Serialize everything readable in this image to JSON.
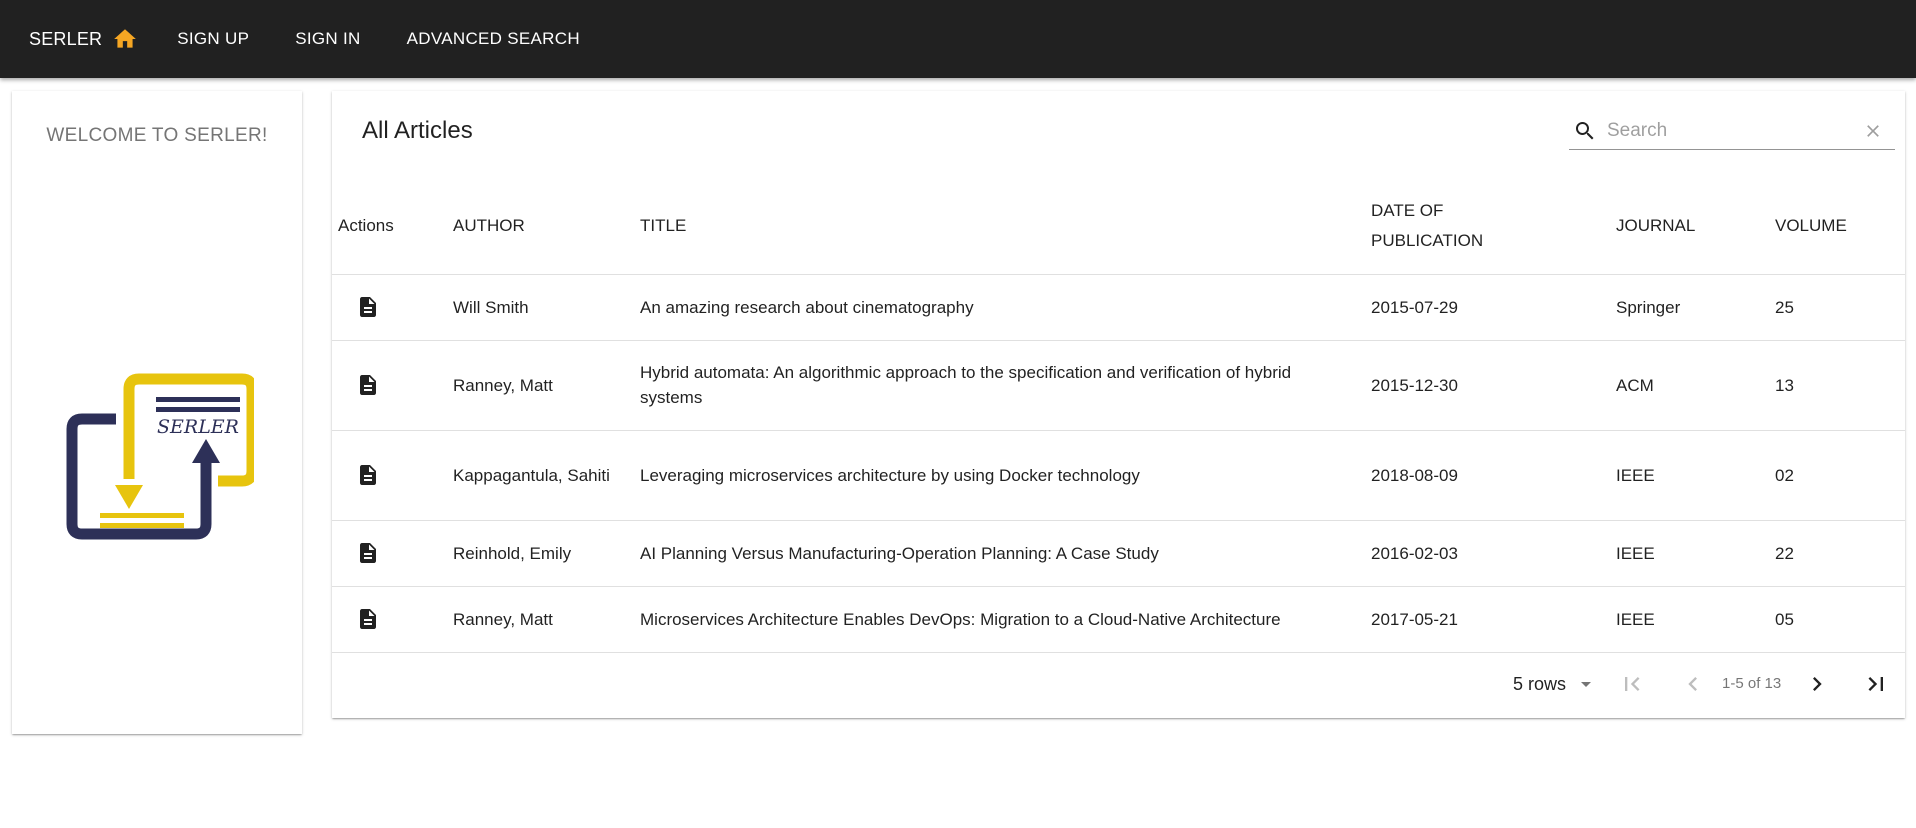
{
  "nav": {
    "brand": "SERLER",
    "sign_up": "SIGN UP",
    "sign_in": "SIGN IN",
    "advanced_search": "ADVANCED SEARCH",
    "home_icon": "home-icon",
    "accent_color": "#f5a623"
  },
  "sidebar": {
    "welcome": "WELCOME TO SERLER!",
    "logo_text": "SERLER"
  },
  "main": {
    "title": "All Articles",
    "search": {
      "placeholder": "Search",
      "value": ""
    },
    "columns": {
      "actions": "Actions",
      "author": "AUTHOR",
      "title": "TITLE",
      "date_line1": "DATE OF",
      "date_line2": "PUBLICATION",
      "journal": "JOURNAL",
      "volume": "VOLUME"
    },
    "rows": [
      {
        "author": "Will Smith",
        "title": "An amazing research about cinematography",
        "date": "2015-07-29",
        "journal": "Springer",
        "volume": "25"
      },
      {
        "author": "Ranney, Matt",
        "title": "Hybrid automata: An algorithmic approach to the specification and verification of hybrid systems",
        "date": "2015-12-30",
        "journal": "ACM",
        "volume": "13"
      },
      {
        "author": "Kappagantula, Sahiti",
        "title": "Leveraging microservices architecture by using Docker technology",
        "date": "2018-08-09",
        "journal": "IEEE",
        "volume": "02"
      },
      {
        "author": "Reinhold, Emily",
        "title": "AI Planning Versus Manufacturing-Operation Planning: A Case Study",
        "date": "2016-02-03",
        "journal": "IEEE",
        "volume": "22"
      },
      {
        "author": "Ranney, Matt",
        "title": "Microservices Architecture Enables DevOps: Migration to a Cloud-Native Architecture",
        "date": "2017-05-21",
        "journal": "IEEE",
        "volume": "05"
      }
    ],
    "pagination": {
      "rows_label": "5 rows",
      "range": "1-5 of 13"
    }
  }
}
